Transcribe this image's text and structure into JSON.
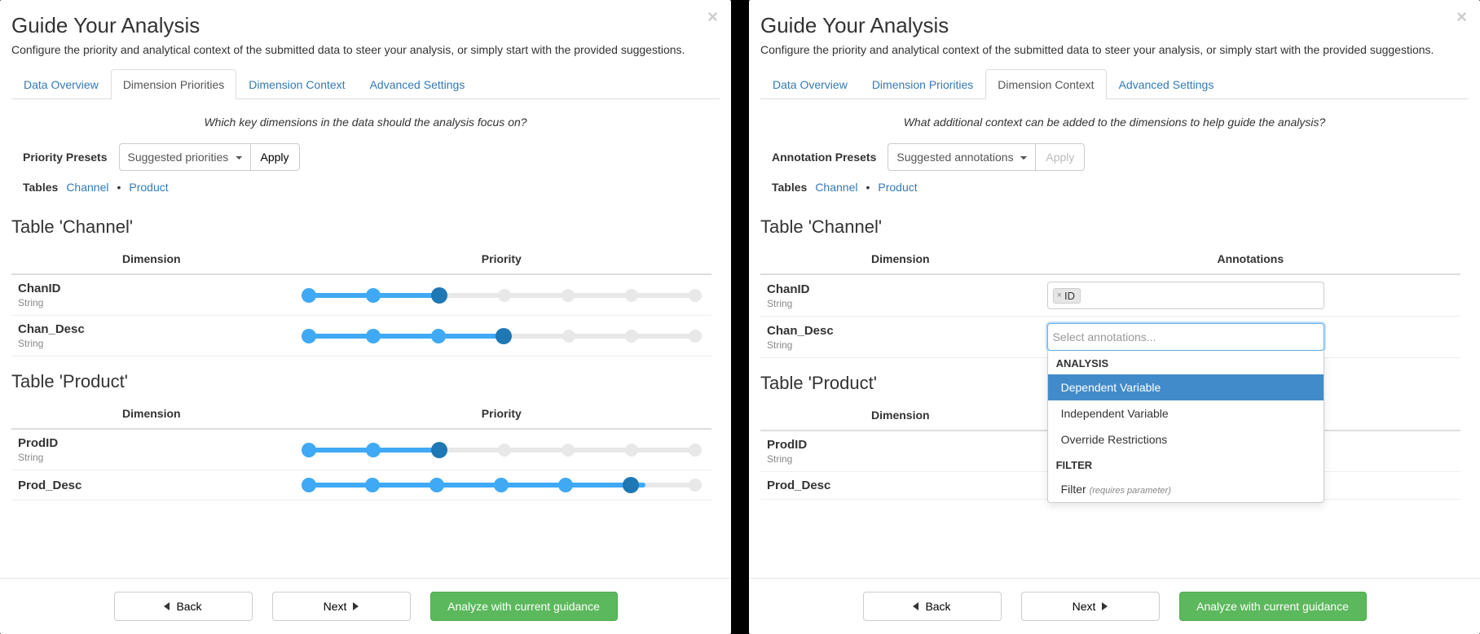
{
  "shared": {
    "title": "Guide Your Analysis",
    "subtitle": "Configure the priority and analytical context of the submitted data to steer your analysis, or simply start with the provided suggestions.",
    "tabs": [
      "Data Overview",
      "Dimension Priorities",
      "Dimension Context",
      "Advanced Settings"
    ],
    "tables_label": "Tables",
    "tables": [
      "Channel",
      "Product"
    ],
    "footer": {
      "back": "Back",
      "next": "Next",
      "analyze": "Analyze with current guidance"
    }
  },
  "left": {
    "active_tab": "Dimension Priorities",
    "prompt": "Which key dimensions in the data should the analysis focus on?",
    "preset_label": "Priority Presets",
    "preset_value": "Suggested priorities",
    "apply": "Apply",
    "columns": [
      "Dimension",
      "Priority"
    ],
    "sections": [
      {
        "title": "Table 'Channel'",
        "rows": [
          {
            "name": "ChanID",
            "type": "String",
            "value": 3,
            "max": 7
          },
          {
            "name": "Chan_Desc",
            "type": "String",
            "value": 4,
            "max": 7
          }
        ]
      },
      {
        "title": "Table 'Product'",
        "rows": [
          {
            "name": "ProdID",
            "type": "String",
            "value": 3,
            "max": 7
          },
          {
            "name": "Prod_Desc",
            "type": "",
            "value": 6,
            "max": 7
          }
        ]
      }
    ]
  },
  "right": {
    "active_tab": "Dimension Context",
    "prompt": "What additional context can be added to the dimensions to help guide the analysis?",
    "preset_label": "Annotation Presets",
    "preset_value": "Suggested annotations",
    "apply": "Apply",
    "columns": [
      "Dimension",
      "Annotations"
    ],
    "sections": [
      {
        "title": "Table 'Channel'",
        "rows": [
          {
            "name": "ChanID",
            "type": "String",
            "tags": [
              "ID"
            ],
            "open": false
          },
          {
            "name": "Chan_Desc",
            "type": "String",
            "placeholder": "Select annotations...",
            "open": true
          }
        ]
      },
      {
        "title": "Table 'Product'",
        "rows": [
          {
            "name": "ProdID",
            "type": "String"
          },
          {
            "name": "Prod_Desc",
            "type": ""
          }
        ]
      }
    ],
    "dropdown": {
      "groups": [
        {
          "label": "ANALYSIS",
          "items": [
            {
              "label": "Dependent Variable",
              "highlight": true
            },
            {
              "label": "Independent Variable"
            },
            {
              "label": "Override Restrictions"
            }
          ]
        },
        {
          "label": "FILTER",
          "items": [
            {
              "label": "Filter",
              "hint": "(requires parameter)"
            }
          ]
        }
      ]
    }
  }
}
